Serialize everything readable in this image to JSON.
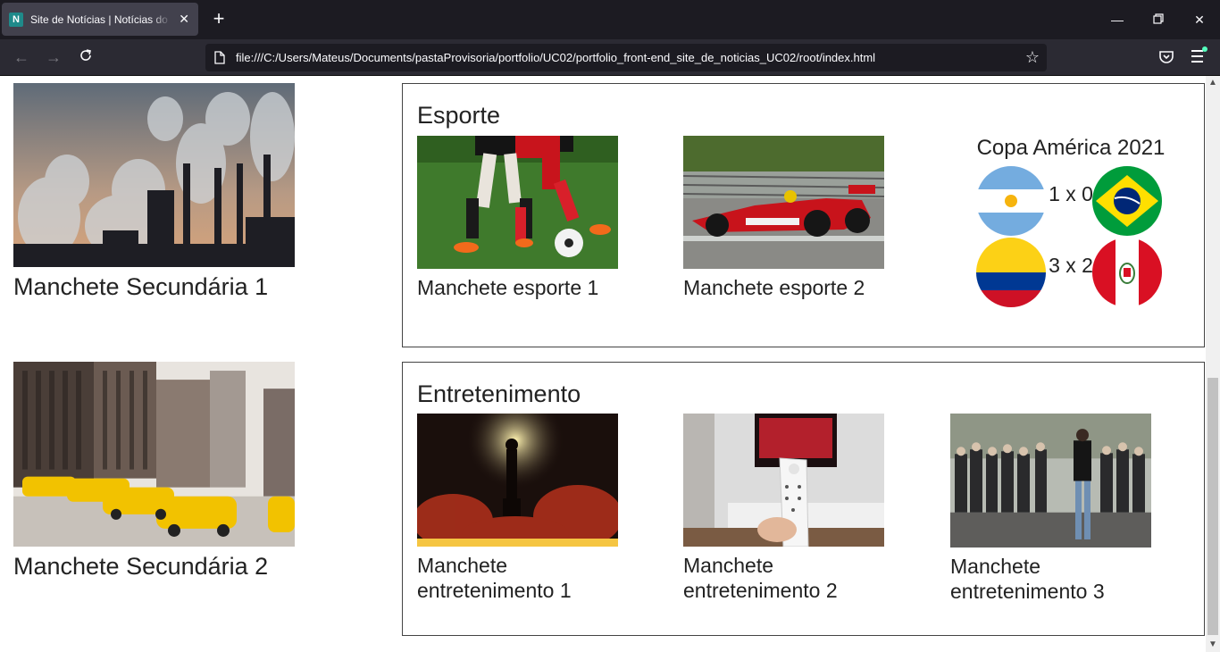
{
  "browser": {
    "tab_title": "Site de Notícias | Notícias do Brasil",
    "tab_favicon_letter": "N",
    "url": "file:///C:/Users/Mateus/Documents/pastaProvisoria/portfolio/UC02/portfolio_front-end_site_de_noticias_UC02/root/index.html",
    "icons": [
      "close-icon",
      "plus-icon",
      "minimize-icon",
      "restore-icon",
      "back-icon",
      "forward-icon",
      "reload-icon",
      "page-icon",
      "star-icon",
      "pocket-icon",
      "menu-icon"
    ]
  },
  "secondary_headlines": [
    {
      "title": "Manchete Secundária 1"
    },
    {
      "title": "Manchete Secundária 2"
    }
  ],
  "sports": {
    "title": "Esporte",
    "cards": [
      {
        "title": "Manchete esporte 1"
      },
      {
        "title": "Manchete esporte 2"
      }
    ],
    "scoreboard": {
      "title": "Copa América 2021",
      "matches": [
        {
          "result": "1 x 0",
          "home": "argentina-flag",
          "away": "brazil-flag"
        },
        {
          "result": "3 x 2",
          "home": "colombia-flag",
          "away": "peru-flag"
        }
      ]
    }
  },
  "entertainment": {
    "title": "Entretenimento",
    "cards": [
      {
        "title": "Manchete entretenimento 1"
      },
      {
        "title": "Manchete entretenimento 2"
      },
      {
        "title": "Manchete entretenimento 3"
      }
    ]
  },
  "colors": {
    "chrome_dark": "#1c1b22",
    "chrome_toolbar": "#2b2a33",
    "section_border": "#444444"
  }
}
